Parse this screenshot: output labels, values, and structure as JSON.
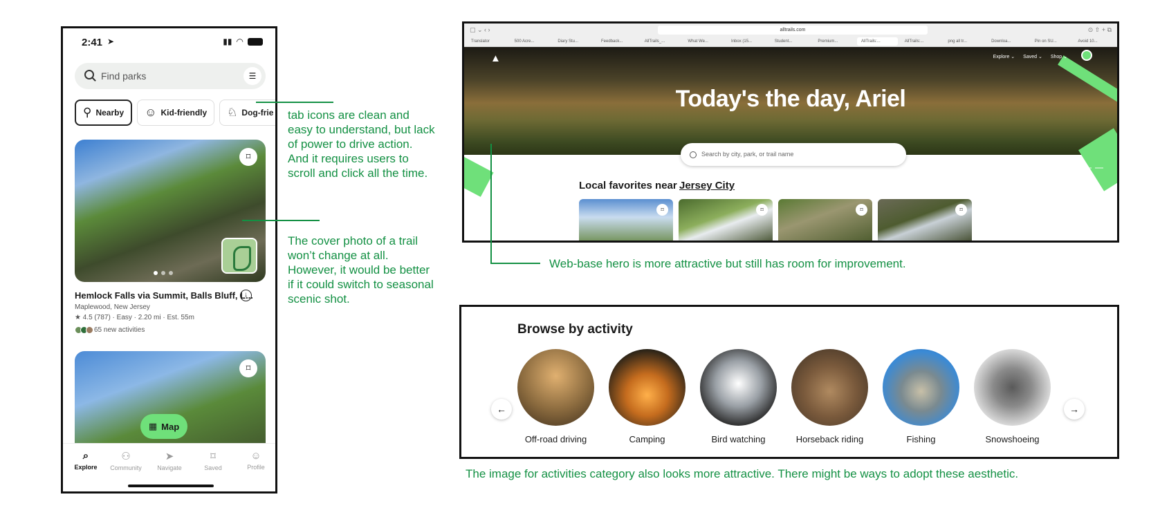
{
  "phone": {
    "status": {
      "time": "2:41"
    },
    "search": {
      "placeholder": "Find parks"
    },
    "chips": [
      {
        "label": "Nearby",
        "icon": "hiker-pin-icon",
        "glyph": "⚲"
      },
      {
        "label": "Kid-friendly",
        "icon": "family-icon",
        "glyph": "☺"
      },
      {
        "label": "Dog-frie",
        "icon": "dog-icon",
        "glyph": "♘"
      }
    ],
    "trail": {
      "title": "Hemlock Falls via Summit, Balls Bluff, L...",
      "location": "Maplewood, New Jersey",
      "meta": "★ 4.5 (787)  ·  Easy  ·  2.20 mi  ·  Est. 55m",
      "activities": "65 new activities"
    },
    "map_button": "Map",
    "tabs": [
      {
        "label": "Explore",
        "glyph": "⌕",
        "icon": "explore-icon"
      },
      {
        "label": "Community",
        "glyph": "⚇",
        "icon": "community-icon"
      },
      {
        "label": "Navigate",
        "glyph": "➤",
        "icon": "navigate-icon"
      },
      {
        "label": "Saved",
        "glyph": "⌑",
        "icon": "bookmark-icon"
      },
      {
        "label": "Profile",
        "glyph": "☺",
        "icon": "profile-icon"
      }
    ]
  },
  "annotations": {
    "tabs": "tab icons are clean and easy to understand, but lack of power to drive action. And it requires users to scroll and click all the time.",
    "cover": "The cover photo of a trail won’t change at all. However, it would be better if it could switch to seasonal scenic shot.",
    "hero": "Web-base hero is more attractive but still has room for improvement.",
    "activities": "The image for activities category also looks more attractive. There might be ways to adopt these aesthetic."
  },
  "browser": {
    "url": "alltrails.com",
    "tabs": [
      "Translator",
      "500 Acre...",
      "Diary Stu...",
      "Feedback...",
      "AllTrails_...",
      "What We...",
      "Inbox (15...",
      "Student...",
      "Premium...",
      "AllTrails:...",
      "AllTrails:...",
      "png all tr...",
      "Downloa...",
      "Pin on SU...",
      "Avoid 10..."
    ],
    "nav": [
      "Explore ⌄",
      "Saved ⌄",
      "Shop ⌄"
    ],
    "hero_title": "Today's the day, Ariel",
    "search_placeholder": "Search by city, park, or trail name",
    "local_title": "Local favorites near",
    "local_city": "Jersey City"
  },
  "activities": {
    "title": "Browse by activity",
    "items": [
      {
        "label": "Off-road driving",
        "color": "#8a6a3e"
      },
      {
        "label": "Camping",
        "color": "#c56c1e"
      },
      {
        "label": "Bird watching",
        "color": "#9aa0a6"
      },
      {
        "label": "Horseback riding",
        "color": "#7a5a3c"
      },
      {
        "label": "Fishing",
        "color": "#3a8ad6"
      },
      {
        "label": "Snowshoeing",
        "color": "#d8d8d8"
      }
    ]
  },
  "colors": {
    "annotation": "#139043",
    "accent": "#6fe07a"
  }
}
